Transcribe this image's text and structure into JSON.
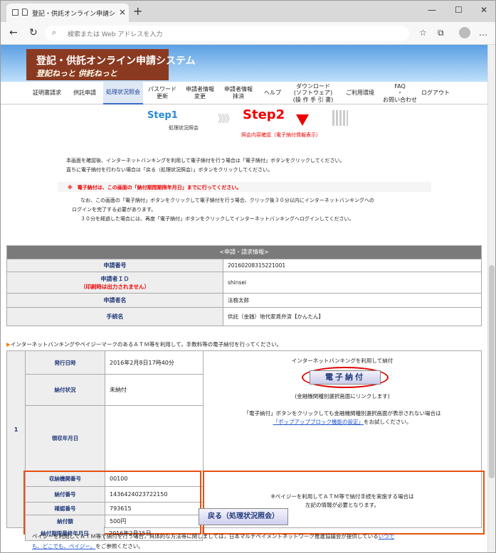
{
  "browser": {
    "tab_title": "登記・供託オンライン申請システム・",
    "tab_close": "×",
    "new_tab": "+",
    "minimize": "—",
    "maximize": "☐",
    "close": "✕",
    "back": "←",
    "reload": "↻",
    "address_placeholder": "検索または Web アドレスを入力",
    "more": "…"
  },
  "banner": {
    "title": "登記・供託オンライン申請システム",
    "subtitle": "登記ねっと 供託ねっと"
  },
  "nav": [
    {
      "label": "証明書請求"
    },
    {
      "label": "供託申請"
    },
    {
      "label": "処理状況照会"
    },
    {
      "label": "パスワード\n更新"
    },
    {
      "label": "申請者情報\n変更"
    },
    {
      "label": "申請者情報\n抹消"
    },
    {
      "label": "ヘルプ"
    },
    {
      "label": "ダウンロード\n(ソフトウェア)\n(操 作 手 引 書)"
    },
    {
      "label": "ご利用環境"
    },
    {
      "label": "FAQ\n・\nお問い合わせ"
    },
    {
      "label": "ログアウト"
    }
  ],
  "steps": {
    "step1": "Step1",
    "step1_sub": "処理状況照会",
    "arrows": "》》》",
    "step2": "Step2",
    "step2_sub": "照会内容確認（電子納付情報表示）"
  },
  "intro": [
    "本画面を確認後、インターネットバンキングを利用して電子納付を行う場合は「電子納付」ボタンをクリックしてください。",
    "直ちに電子納付を行わない場合は「戻る（処理状況照会）」ボタンをクリックしてください。"
  ],
  "warning": "※　電子納付は、この画面の「納付期間期限年月日」までに行ってください。",
  "notice": [
    "なお、この画面の「電子納付」ボタンをクリックして電子納付を行う場合、クリック後３０分以内にインターネットバンキングへの",
    "ログインを完了する必要があります。",
    "３０分を経過した場合には、再度「電子納付」ボタンをクリックしてインターネットバンキングへログインしてください。"
  ],
  "application": {
    "header": "<申請・請求情報>",
    "rows": [
      {
        "key": "申請番号",
        "note": "",
        "value": "20160208315221001"
      },
      {
        "key": "申請者ＩＤ",
        "note": "（印刷時は出力されません）",
        "value": "shinsei"
      },
      {
        "key": "申請者名",
        "note": "",
        "value": "法務太郎"
      },
      {
        "key": "手続名",
        "note": "",
        "value": "供託（金銭）地代家賃弁済【かんたん】"
      }
    ]
  },
  "pay_note": "インターネットバンキングやペイジーマークのあるＡＴＭ等を利用して，手数料等の電子納付を行ってください。",
  "pay_note_icon": "triangle-right-icon",
  "payment": {
    "index": "1",
    "rows": [
      {
        "key": "発行日時",
        "value": "2016年2月8日17時40分"
      },
      {
        "key": "納付状況",
        "value": "未納付"
      },
      {
        "key": "領収年月日",
        "value": ""
      },
      {
        "key": "収納機関番号",
        "value": "00100"
      },
      {
        "key": "納付番号",
        "value": "1436424023722150"
      },
      {
        "key": "確認番号",
        "value": "793615"
      },
      {
        "key": "納付額",
        "value": "500円"
      },
      {
        "key": "納付期限最終年月日",
        "value": "2016年2月15日"
      }
    ],
    "ib_label": "インターネットバンキングを利用して納付",
    "pay_button": "電子納付",
    "link_note": "(金融機関種別選択画面にリンクします)",
    "popup_note_1": "「電子納付」ボタンをクリックしても金融機関種別選択画面が表示されない場合は",
    "popup_link": "「ポップアップブロック機能の設定」",
    "popup_note_2": "をお試しください。",
    "atm_note_1": "※ペイジーを利用してＡＴＭ等で納付手続を実施する場合は",
    "atm_note_2": "左記の情報が必要となります。"
  },
  "back_button": "戻る（処理状況照会）",
  "footer": {
    "text_1": "ペイジーを利用してＡＴＭ等で納付を行う場合，具体的な方法等に関しましては，日本マルチペイメントネットワーク推進協議会が提供している",
    "link_1": "いつで",
    "link_2": "も、どこでも、ペイジー。",
    "text_2": "をご参照ください。"
  },
  "colors": {
    "accent_red": "#e00000",
    "highlight_orange": "#e85010",
    "link_blue": "#2255cc",
    "header_gray": "#7a7a7a"
  }
}
